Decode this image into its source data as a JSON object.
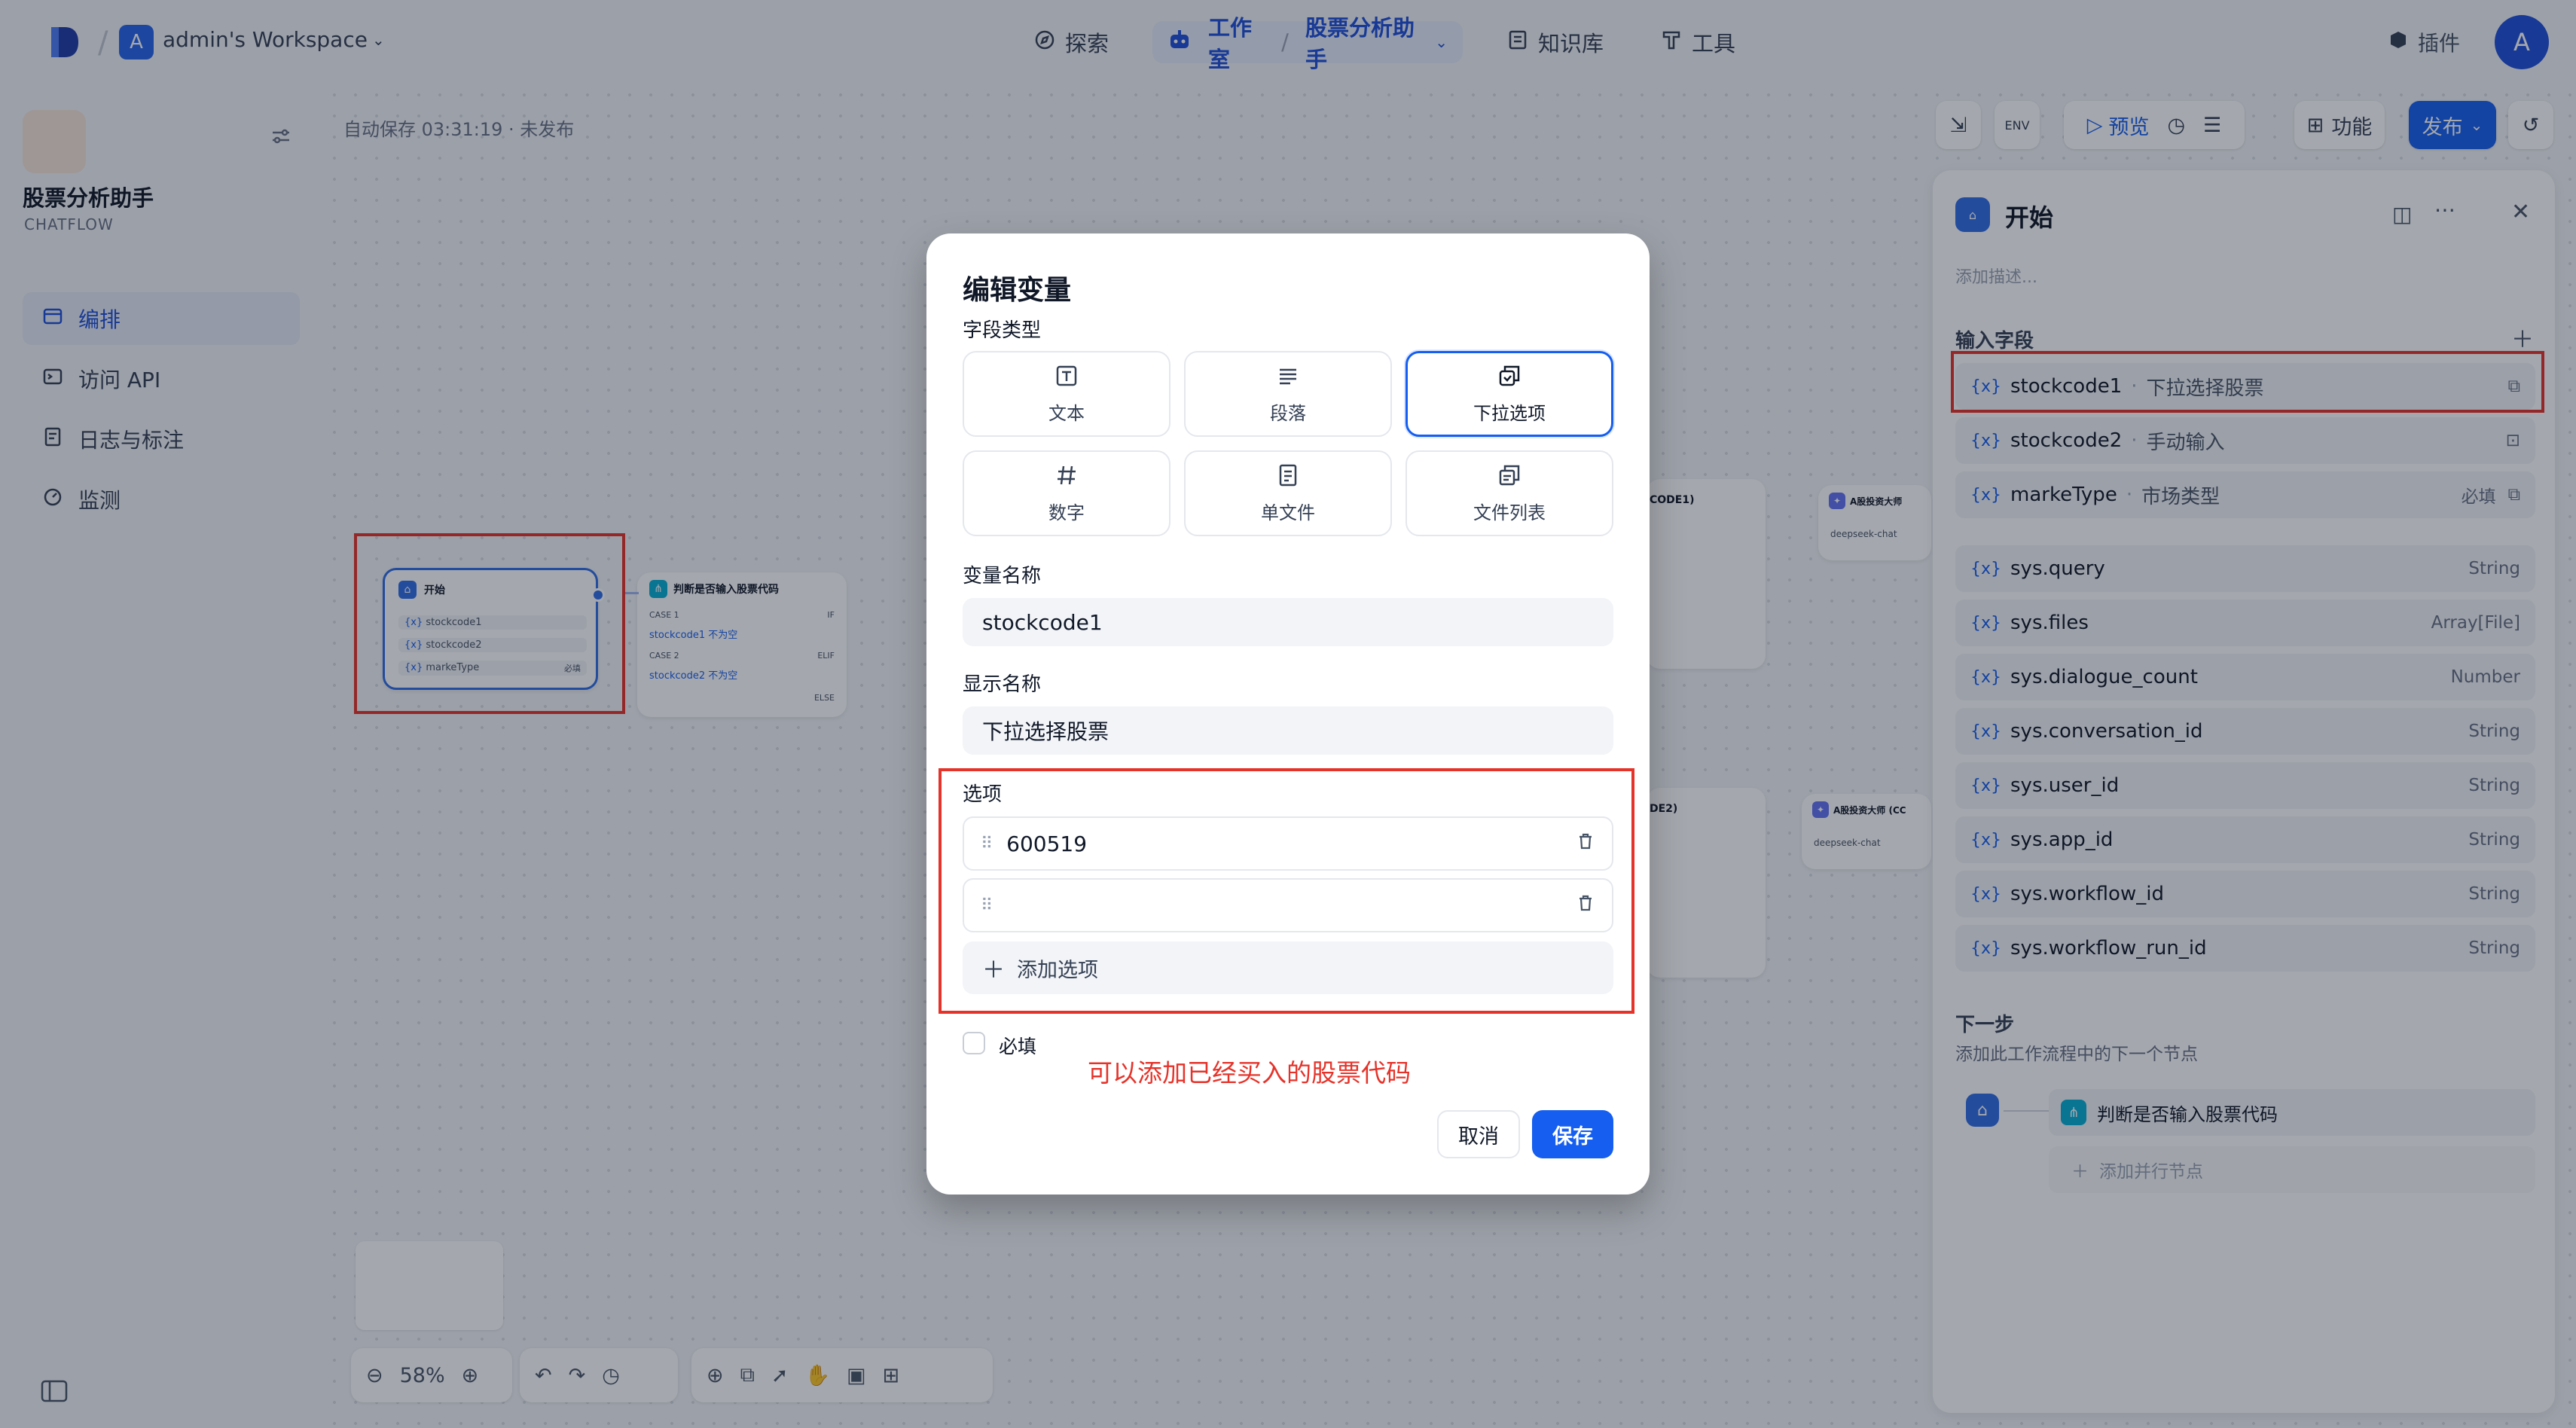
{
  "colors": {
    "accent": "#155eef",
    "annotation_red": "#e5332a",
    "overlay": "rgba(16,24,40,0.38)"
  },
  "header": {
    "workspace_avatar": "A",
    "workspace_name": "admin's Workspace",
    "nav": {
      "explore": "探索",
      "studio": "工作室",
      "current_app": "股票分析助手",
      "knowledge": "知识库",
      "tools": "工具"
    },
    "plugins": "插件",
    "user_avatar": "A"
  },
  "sidebar": {
    "app_name": "股票分析助手",
    "app_type": "CHATFLOW",
    "items": [
      {
        "label": "编排",
        "icon": "layout-icon",
        "active": true
      },
      {
        "label": "访问 API",
        "icon": "terminal-icon",
        "active": false
      },
      {
        "label": "日志与标注",
        "icon": "log-icon",
        "active": false
      },
      {
        "label": "监测",
        "icon": "monitor-icon",
        "active": false
      }
    ]
  },
  "canvas": {
    "autosave": "自动保存 03:31:19 · 未发布",
    "toolbar": {
      "preview": "预览",
      "features": "功能",
      "publish": "发布"
    },
    "zoom": "58%",
    "start_node": {
      "title": "开始",
      "vars": [
        "stockcode1",
        "stockcode2",
        "markeType"
      ],
      "required_tag": "必填"
    },
    "if_node": {
      "title": "判断是否输入股票代码",
      "case1": "CASE 1",
      "case1_cond": "stockcode1 不为空",
      "case2": "CASE 2",
      "case2_cond": "stockcode2 不为空",
      "if": "IF",
      "elif": "ELIF",
      "else": "ELSE"
    },
    "llm_a_label": "A股投资大师",
    "llm_b_label": "A股投资大师 (CC",
    "llm_model": "deepseek-chat",
    "code1": "CODE1)",
    "code2": "DE2)"
  },
  "modal": {
    "title": "编辑变量",
    "field_type_label": "字段类型",
    "types": [
      {
        "label": "文本",
        "icon": "text-icon",
        "selected": false
      },
      {
        "label": "段落",
        "icon": "paragraph-icon",
        "selected": false
      },
      {
        "label": "下拉选项",
        "icon": "select-icon",
        "selected": true
      },
      {
        "label": "数字",
        "icon": "number-icon",
        "selected": false
      },
      {
        "label": "单文件",
        "icon": "file-icon",
        "selected": false
      },
      {
        "label": "文件列表",
        "icon": "file-list-icon",
        "selected": false
      }
    ],
    "var_name_label": "变量名称",
    "var_name_value": "stockcode1",
    "display_name_label": "显示名称",
    "display_name_value": "下拉选择股票",
    "options_label": "选项",
    "options": [
      "600519",
      ""
    ],
    "add_option": "添加选项",
    "required_label": "必填",
    "required_checked": false,
    "annotation": "可以添加已经买入的股票代码",
    "cancel": "取消",
    "save": "保存"
  },
  "right_panel": {
    "title": "开始",
    "description_placeholder": "添加描述...",
    "input_fields_label": "输入字段",
    "input_fields": [
      {
        "name": "stockcode1",
        "label": "下拉选择股票",
        "required": "",
        "icon": "select-icon"
      },
      {
        "name": "stockcode2",
        "label": "手动输入",
        "required": "",
        "icon": "text-icon"
      },
      {
        "name": "markeType",
        "label": "市场类型",
        "required": "必填",
        "icon": "select-icon"
      }
    ],
    "sys_vars": [
      {
        "name": "sys.query",
        "type": "String"
      },
      {
        "name": "sys.files",
        "type": "Array[File]"
      },
      {
        "name": "sys.dialogue_count",
        "type": "Number"
      },
      {
        "name": "sys.conversation_id",
        "type": "String"
      },
      {
        "name": "sys.user_id",
        "type": "String"
      },
      {
        "name": "sys.app_id",
        "type": "String"
      },
      {
        "name": "sys.workflow_id",
        "type": "String"
      },
      {
        "name": "sys.workflow_run_id",
        "type": "String"
      }
    ],
    "next_step_label": "下一步",
    "next_step_desc": "添加此工作流程中的下一个节点",
    "next_node": "判断是否输入股票代码",
    "add_parallel": "添加并行节点"
  }
}
